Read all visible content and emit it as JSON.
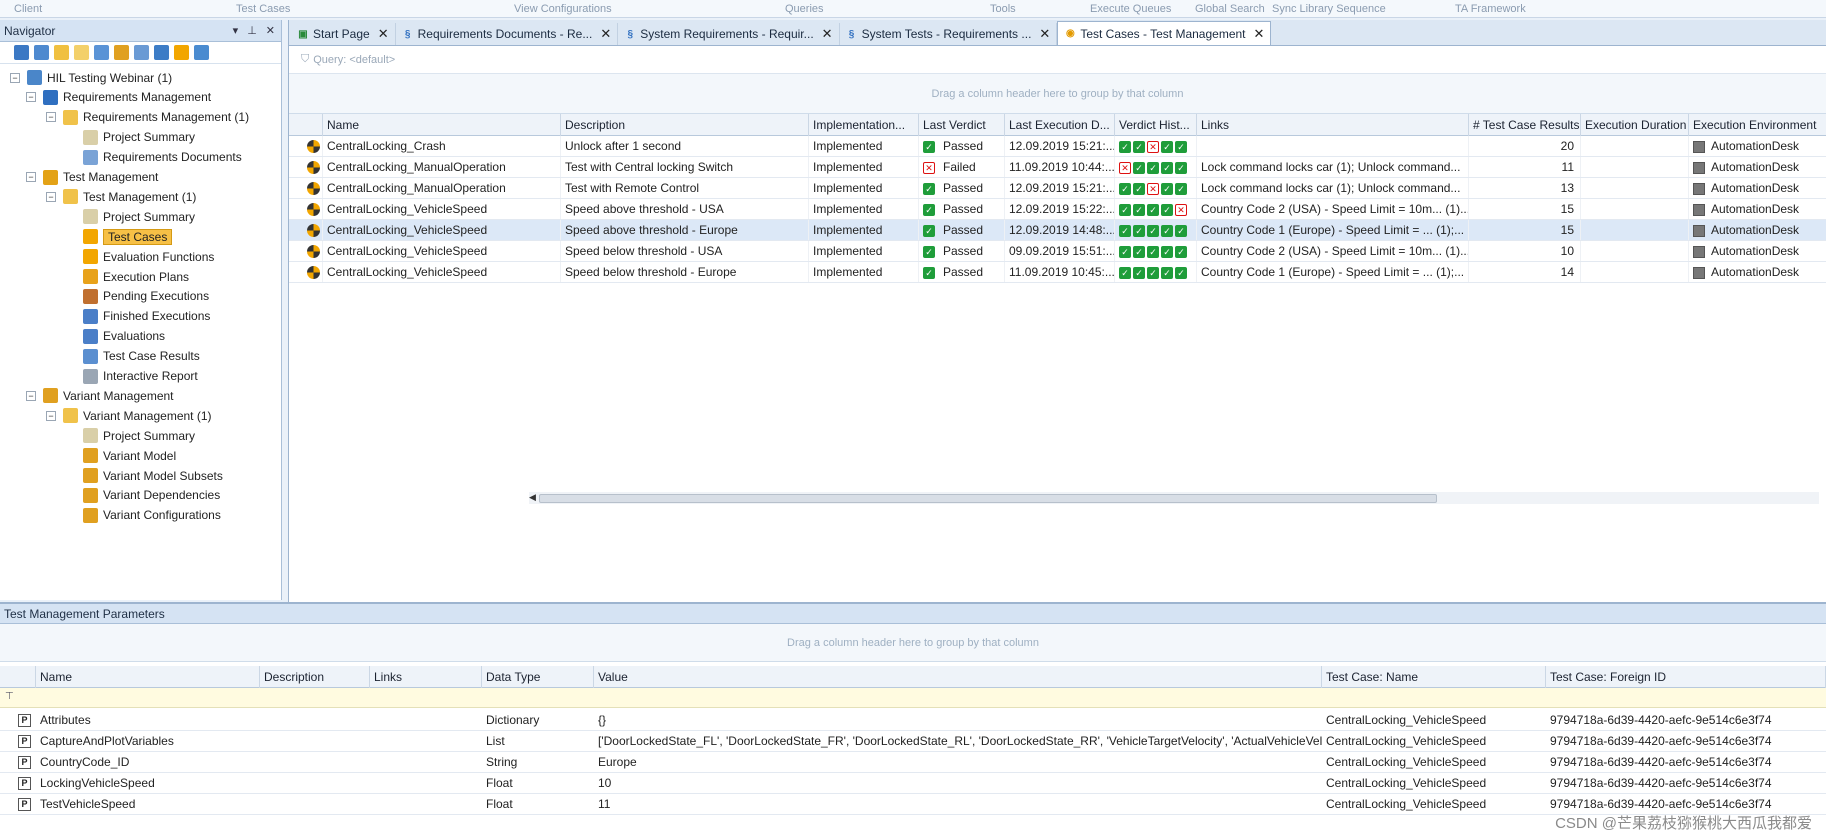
{
  "ribbon": {
    "groups": [
      "Client",
      "Test Cases",
      "View Configurations",
      "Queries",
      "Tools",
      "Execute Queues",
      "Global Search",
      "Sync Library Sequence",
      "TA Framework"
    ]
  },
  "navigator": {
    "title": "Navigator",
    "tree": [
      {
        "label": "HIL Testing Webinar (1)",
        "level": 0,
        "exp": "minus",
        "icon": "project-icon"
      },
      {
        "label": "Requirements Management",
        "level": 1,
        "exp": "minus",
        "icon": "requirements-icon"
      },
      {
        "label": "Requirements Management (1)",
        "level": 2,
        "exp": "minus",
        "icon": "folder-icon"
      },
      {
        "label": "Project Summary",
        "level": 3,
        "exp": "",
        "icon": "summary-icon"
      },
      {
        "label": "Requirements Documents",
        "level": 3,
        "exp": "",
        "icon": "requirements-doc-icon"
      },
      {
        "label": "Test Management",
        "level": 1,
        "exp": "minus",
        "icon": "test-management-icon"
      },
      {
        "label": "Test Management  (1)",
        "level": 2,
        "exp": "minus",
        "icon": "folder-icon"
      },
      {
        "label": "Project Summary",
        "level": 3,
        "exp": "",
        "icon": "summary-icon"
      },
      {
        "label": "Test Cases",
        "level": 3,
        "exp": "",
        "icon": "test-case-icon",
        "selected": true
      },
      {
        "label": "Evaluation Functions",
        "level": 3,
        "exp": "",
        "icon": "evaluation-function-icon"
      },
      {
        "label": "Execution Plans",
        "level": 3,
        "exp": "",
        "icon": "execution-plan-icon"
      },
      {
        "label": "Pending Executions",
        "level": 3,
        "exp": "",
        "icon": "pending-icon"
      },
      {
        "label": "Finished Executions",
        "level": 3,
        "exp": "",
        "icon": "finished-icon"
      },
      {
        "label": "Evaluations",
        "level": 3,
        "exp": "",
        "icon": "evaluations-icon"
      },
      {
        "label": "Test Case Results",
        "level": 3,
        "exp": "",
        "icon": "results-icon"
      },
      {
        "label": "Interactive Report",
        "level": 3,
        "exp": "",
        "icon": "report-icon"
      },
      {
        "label": "Variant Management",
        "level": 1,
        "exp": "minus",
        "icon": "variant-management-icon"
      },
      {
        "label": "Variant Management (1)",
        "level": 2,
        "exp": "minus",
        "icon": "folder-icon"
      },
      {
        "label": "Project Summary",
        "level": 3,
        "exp": "",
        "icon": "summary-icon"
      },
      {
        "label": "Variant Model",
        "level": 3,
        "exp": "",
        "icon": "variant-model-icon"
      },
      {
        "label": "Variant Model Subsets",
        "level": 3,
        "exp": "",
        "icon": "variant-subsets-icon"
      },
      {
        "label": "Variant Dependencies",
        "level": 3,
        "exp": "",
        "icon": "variant-dependencies-icon"
      },
      {
        "label": "Variant Configurations",
        "level": 3,
        "exp": "",
        "icon": "variant-configurations-icon"
      }
    ]
  },
  "tabs": [
    {
      "label": "Start Page",
      "icon": "start-page-icon",
      "active": false
    },
    {
      "label": "Requirements Documents - Re...",
      "icon": "requirements-icon",
      "active": false
    },
    {
      "label": "System Requirements - Requir...",
      "icon": "requirements-icon",
      "active": false
    },
    {
      "label": "System Tests - Requirements ...",
      "icon": "requirements-icon",
      "active": false
    },
    {
      "label": "Test Cases - Test Management",
      "icon": "test-case-icon",
      "active": true
    }
  ],
  "query": {
    "label": "Query: <default>"
  },
  "group_hint": "Drag a column header here to group by that column",
  "test_grid": {
    "columns": [
      "Name",
      "Description",
      "Implementation...",
      "Last Verdict",
      "Last Execution D...",
      "Verdict Hist...",
      "Links",
      "# Test Case Results",
      "Execution Duration",
      "Execution Environment"
    ],
    "rows": [
      {
        "name": "CentralLocking_Crash",
        "description": "Unlock after 1 second",
        "implementation": "Implemented",
        "verdict": "Passed",
        "last_exec": "12.09.2019 15:21:...",
        "history": [
          "p",
          "p",
          "f",
          "p",
          "p"
        ],
        "links": "",
        "results": "20",
        "duration": "",
        "environment": "AutomationDesk"
      },
      {
        "name": "CentralLocking_ManualOperation",
        "description": "Test with Central locking Switch",
        "implementation": "Implemented",
        "verdict": "Failed",
        "last_exec": "11.09.2019 10:44:...",
        "history": [
          "f",
          "p",
          "p",
          "p",
          "p"
        ],
        "links": "Lock command locks car (1); Unlock command...",
        "results": "11",
        "duration": "",
        "environment": "AutomationDesk"
      },
      {
        "name": "CentralLocking_ManualOperation",
        "description": "Test with Remote Control",
        "implementation": "Implemented",
        "verdict": "Passed",
        "last_exec": "12.09.2019 15:21:...",
        "history": [
          "p",
          "p",
          "f",
          "p",
          "p"
        ],
        "links": "Lock command locks car (1); Unlock command...",
        "results": "13",
        "duration": "",
        "environment": "AutomationDesk"
      },
      {
        "name": "CentralLocking_VehicleSpeed",
        "description": "Speed above threshold - USA",
        "implementation": "Implemented",
        "verdict": "Passed",
        "last_exec": "12.09.2019 15:22:...",
        "history": [
          "p",
          "p",
          "p",
          "p",
          "f"
        ],
        "links": "Country Code 2 (USA) - Speed Limit = 10m... (1)...",
        "results": "15",
        "duration": "",
        "environment": "AutomationDesk"
      },
      {
        "name": "CentralLocking_VehicleSpeed",
        "description": "Speed above threshold - Europe",
        "implementation": "Implemented",
        "verdict": "Passed",
        "last_exec": "12.09.2019 14:48:...",
        "history": [
          "p",
          "p",
          "p",
          "p",
          "p"
        ],
        "links": "Country Code 1 (Europe) - Speed Limit = ... (1);...",
        "results": "15",
        "duration": "",
        "environment": "AutomationDesk",
        "highlight": true
      },
      {
        "name": "CentralLocking_VehicleSpeed",
        "description": "Speed below threshold - USA",
        "implementation": "Implemented",
        "verdict": "Passed",
        "last_exec": "09.09.2019 15:51:...",
        "history": [
          "p",
          "p",
          "p",
          "p",
          "p"
        ],
        "links": "Country Code 2 (USA) - Speed Limit = 10m... (1)...",
        "results": "10",
        "duration": "",
        "environment": "AutomationDesk"
      },
      {
        "name": "CentralLocking_VehicleSpeed",
        "description": "Speed below threshold - Europe",
        "implementation": "Implemented",
        "verdict": "Passed",
        "last_exec": "11.09.2019 10:45:...",
        "history": [
          "p",
          "p",
          "p",
          "p",
          "p"
        ],
        "links": "Country Code 1 (Europe) - Speed Limit = ... (1);...",
        "results": "14",
        "duration": "",
        "environment": "AutomationDesk"
      }
    ]
  },
  "params_panel": {
    "title": "Test Management Parameters",
    "columns": [
      "Name",
      "Description",
      "Links",
      "Data Type",
      "Value",
      "Test Case: Name",
      "Test Case: Foreign ID"
    ],
    "rows": [
      {
        "name": "Attributes",
        "description": "",
        "links": "",
        "type": "Dictionary",
        "value": "{}",
        "tc_name": "CentralLocking_VehicleSpeed",
        "foreign_id": "9794718a-6d39-4420-aefc-9e514c6e3f74"
      },
      {
        "name": "CaptureAndPlotVariables",
        "description": "",
        "links": "",
        "type": "List",
        "value": "['DoorLockedState_FL', 'DoorLockedState_FR', 'DoorLockedState_RL', 'DoorLockedState_RR', 'VehicleTargetVelocity', 'ActualVehicleVeloci...",
        "tc_name": "CentralLocking_VehicleSpeed",
        "foreign_id": "9794718a-6d39-4420-aefc-9e514c6e3f74"
      },
      {
        "name": "CountryCode_ID",
        "description": "",
        "links": "",
        "type": "String",
        "value": "Europe",
        "tc_name": "CentralLocking_VehicleSpeed",
        "foreign_id": "9794718a-6d39-4420-aefc-9e514c6e3f74"
      },
      {
        "name": "LockingVehicleSpeed",
        "description": "",
        "links": "",
        "type": "Float",
        "value": "10",
        "tc_name": "CentralLocking_VehicleSpeed",
        "foreign_id": "9794718a-6d39-4420-aefc-9e514c6e3f74"
      },
      {
        "name": "TestVehicleSpeed",
        "description": "",
        "links": "",
        "type": "Float",
        "value": "11",
        "tc_name": "CentralLocking_VehicleSpeed",
        "foreign_id": "9794718a-6d39-4420-aefc-9e514c6e3f74"
      }
    ]
  },
  "watermark": "CSDN @芒果荔枝猕猴桃大西瓜我都爱"
}
